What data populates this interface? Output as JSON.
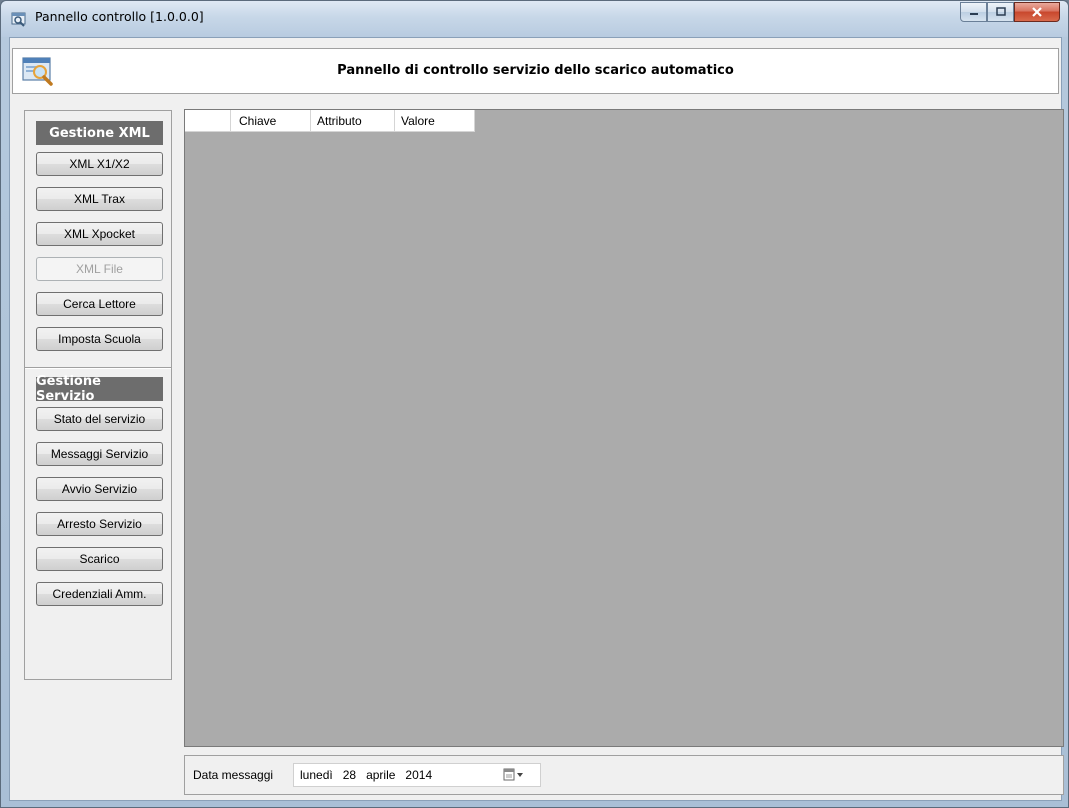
{
  "window": {
    "title": "Pannello controllo [1.0.0.0]",
    "caption_buttons": {
      "minimize": "−",
      "maximize": "□",
      "close": "x"
    }
  },
  "header": {
    "title": "Pannello di controllo servizio dello scarico automatico",
    "icon": "search-window-icon"
  },
  "sidebar": {
    "group_xml": {
      "title": "Gestione XML",
      "buttons": [
        "XML X1/X2",
        "XML Trax",
        "XML Xpocket",
        "XML File",
        "Cerca Lettore",
        "Imposta Scuola"
      ]
    },
    "group_service": {
      "title": "Gestione Servizio",
      "buttons": [
        "Stato del servizio",
        "Messaggi Servizio",
        "Avvio Servizio",
        "Arresto Servizio",
        "Scarico",
        "Credenziali Amm."
      ]
    }
  },
  "grid": {
    "columns": [
      "Chiave",
      "Attributo",
      "Valore"
    ]
  },
  "footer": {
    "label": "Data messaggi",
    "date": {
      "weekday": "lunedì",
      "day": "28",
      "month": "aprile",
      "year": "2014"
    }
  },
  "colors": {
    "group_header_bg": "#6d6d6d",
    "grid_bg": "#ababab",
    "client_bg": "#f0f0f0"
  }
}
